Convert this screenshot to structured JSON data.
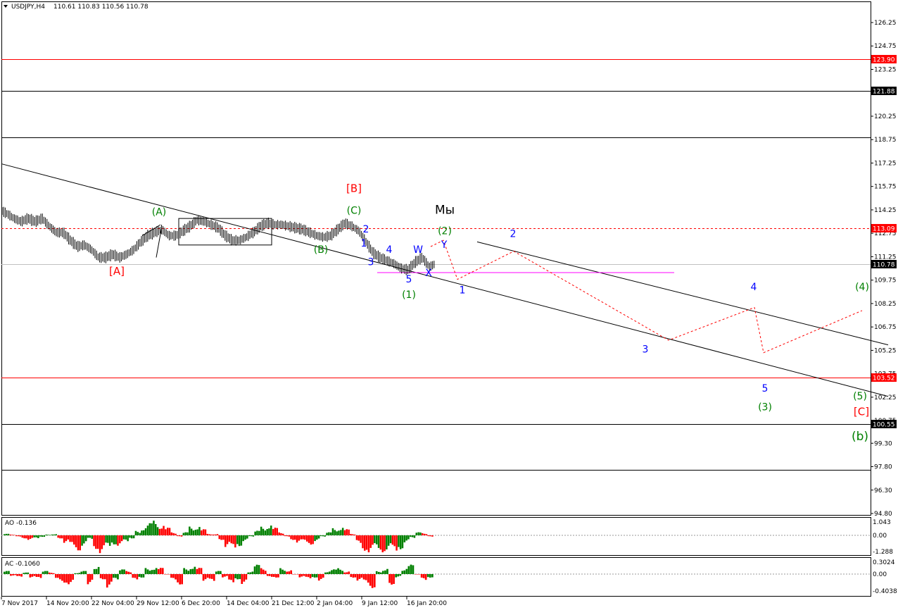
{
  "header": {
    "symbol": "USDJPY,H4",
    "ohlc": "110.61 110.83 110.56 110.78"
  },
  "indicators": {
    "ao": {
      "label": "AO -0.136",
      "ticks": [
        "1.043",
        "0.00",
        "-1.288"
      ]
    },
    "ac": {
      "label": "AC -0.1060",
      "ticks": [
        "0.3024",
        "0.00",
        "-0.4038"
      ]
    }
  },
  "colors": {
    "level_red": "#ff0000",
    "wave_blue": "#0000ff",
    "wave_green": "#008000",
    "forecast": "#ff0000",
    "bar": "#000000",
    "ao_up": "#008000",
    "ao_down": "#ff0000",
    "magenta_line": "#ff00ff",
    "ask_line": "#ff0000"
  },
  "chart_data": {
    "type": "line",
    "title": "USDJPY,H4",
    "y_axis": {
      "ticks": [
        "126.25",
        "124.75",
        "123.25",
        "121.75",
        "120.25",
        "118.75",
        "117.25",
        "115.75",
        "114.25",
        "112.75",
        "111.25",
        "109.75",
        "108.25",
        "106.75",
        "105.25",
        "103.75",
        "102.25",
        "100.75",
        "99.30",
        "97.80",
        "96.30",
        "94.80"
      ],
      "range": [
        94.2,
        127.3
      ]
    },
    "x_axis": {
      "labels": [
        "7 Nov 2017",
        "14 Nov 20:00",
        "22 Nov 04:00",
        "29 Nov 12:00",
        "6 Dec 20:00",
        "14 Dec 04:00",
        "21 Dec 12:00",
        "2 Jan 04:00",
        "9 Jan 12:00",
        "16 Jan 20:00"
      ],
      "range": [
        0,
        1230
      ]
    },
    "price_labels": [
      {
        "value": 123.9,
        "text": "123.90",
        "type": "red"
      },
      {
        "value": 121.88,
        "text": "121.88",
        "type": "black"
      },
      {
        "value": 113.09,
        "text": "113.09",
        "type": "red"
      },
      {
        "value": 110.78,
        "text": "110.78",
        "type": "black"
      },
      {
        "value": 103.52,
        "text": "103.52",
        "type": "red"
      },
      {
        "value": 100.55,
        "text": "100.55",
        "type": "black"
      }
    ],
    "horizontal_levels": [
      {
        "value": 123.9,
        "kind": "red_solid"
      },
      {
        "value": 121.88,
        "kind": "black_solid"
      },
      {
        "value": 118.9,
        "kind": "black_solid"
      },
      {
        "value": 113.09,
        "kind": "red_dashed"
      },
      {
        "value": 110.78,
        "kind": "gray_solid"
      },
      {
        "value": 103.52,
        "kind": "red_solid"
      },
      {
        "value": 100.55,
        "kind": "black_solid"
      },
      {
        "value": 97.6,
        "kind": "black_solid"
      }
    ],
    "series": [
      {
        "name": "",
        "kind": "price",
        "points": [
          [
            2,
            114.2
          ],
          [
            10,
            114.0
          ],
          [
            20,
            113.7
          ],
          [
            30,
            113.5
          ],
          [
            40,
            113.7
          ],
          [
            50,
            113.5
          ],
          [
            60,
            113.7
          ],
          [
            70,
            113.2
          ],
          [
            80,
            112.8
          ],
          [
            90,
            112.8
          ],
          [
            100,
            112.3
          ],
          [
            110,
            111.9
          ],
          [
            120,
            112.0
          ],
          [
            130,
            111.7
          ],
          [
            140,
            111.2
          ],
          [
            150,
            111.2
          ],
          [
            160,
            111.4
          ],
          [
            170,
            111.2
          ],
          [
            180,
            111.4
          ],
          [
            190,
            111.7
          ],
          [
            200,
            112.2
          ],
          [
            210,
            112.6
          ],
          [
            220,
            112.8
          ],
          [
            230,
            113.0
          ],
          [
            240,
            112.6
          ],
          [
            250,
            112.6
          ],
          [
            260,
            112.9
          ],
          [
            270,
            113.2
          ],
          [
            280,
            113.6
          ],
          [
            290,
            113.5
          ],
          [
            300,
            113.3
          ],
          [
            310,
            113.1
          ],
          [
            320,
            112.6
          ],
          [
            330,
            112.3
          ],
          [
            340,
            112.3
          ],
          [
            350,
            112.5
          ],
          [
            360,
            112.8
          ],
          [
            370,
            113.2
          ],
          [
            380,
            113.4
          ],
          [
            390,
            113.3
          ],
          [
            400,
            113.3
          ],
          [
            410,
            113.2
          ],
          [
            420,
            113.1
          ],
          [
            430,
            113.0
          ],
          [
            440,
            112.8
          ],
          [
            450,
            112.6
          ],
          [
            460,
            112.5
          ],
          [
            470,
            112.6
          ],
          [
            480,
            113.0
          ],
          [
            490,
            113.4
          ],
          [
            500,
            113.2
          ],
          [
            510,
            112.9
          ],
          [
            520,
            112.2
          ],
          [
            530,
            111.5
          ],
          [
            540,
            111.2
          ],
          [
            550,
            111.0
          ],
          [
            560,
            110.8
          ],
          [
            570,
            110.5
          ],
          [
            580,
            110.4
          ],
          [
            590,
            110.9
          ],
          [
            600,
            111.2
          ],
          [
            610,
            110.6
          ],
          [
            618,
            110.78
          ]
        ]
      },
      {
        "name": "",
        "kind": "forecast",
        "points": [
          [
            612,
            111.9
          ],
          [
            630,
            112.3
          ],
          [
            650,
            109.8
          ],
          [
            730,
            111.6
          ],
          [
            950,
            105.9
          ],
          [
            1072,
            108.0
          ],
          [
            1085,
            105.1
          ],
          [
            1225,
            107.8
          ]
        ]
      }
    ],
    "trendlines": [
      {
        "from": [
          2,
          117.2
        ],
        "to": [
          1262,
          102.3
        ]
      },
      {
        "from": [
          678,
          112.2
        ],
        "to": [
          1262,
          105.6
        ]
      }
    ],
    "annotations": [
      {
        "text": "[B]",
        "x": 503,
        "y": 115.4,
        "color": "red",
        "size": 15
      },
      {
        "text": "(C)",
        "x": 503,
        "y": 114.0,
        "color": "green",
        "size": 14
      },
      {
        "text": "(A)",
        "x": 226,
        "y": 113.9,
        "color": "green",
        "size": 14
      },
      {
        "text": "(B)",
        "x": 456,
        "y": 111.5,
        "color": "green",
        "size": 14
      },
      {
        "text": "[A]",
        "x": 166,
        "y": 110.1,
        "color": "red",
        "size": 15
      },
      {
        "text": "Мы",
        "x": 632,
        "y": 114.0,
        "color": "black",
        "size": 17
      },
      {
        "text": "(2)",
        "x": 632,
        "y": 112.7,
        "color": "green",
        "size": 14
      },
      {
        "text": "2",
        "x": 520,
        "y": 112.8,
        "color": "blue",
        "size": 14
      },
      {
        "text": "1",
        "x": 517,
        "y": 111.9,
        "color": "blue",
        "size": 14
      },
      {
        "text": "4",
        "x": 553,
        "y": 111.5,
        "color": "blue",
        "size": 14
      },
      {
        "text": "W",
        "x": 594,
        "y": 111.5,
        "color": "blue",
        "size": 14
      },
      {
        "text": "Y",
        "x": 631,
        "y": 111.8,
        "color": "blue",
        "size": 14
      },
      {
        "text": "3",
        "x": 527,
        "y": 110.7,
        "color": "blue",
        "size": 14
      },
      {
        "text": "X",
        "x": 609,
        "y": 110.0,
        "color": "blue",
        "size": 14
      },
      {
        "text": "5",
        "x": 581,
        "y": 109.6,
        "color": "blue",
        "size": 14
      },
      {
        "text": "(1)",
        "x": 581,
        "y": 108.6,
        "color": "green",
        "size": 14
      },
      {
        "text": "1",
        "x": 657,
        "y": 108.9,
        "color": "blue",
        "size": 14
      },
      {
        "text": "2",
        "x": 729,
        "y": 112.5,
        "color": "blue",
        "size": 14
      },
      {
        "text": "4",
        "x": 1071,
        "y": 109.1,
        "color": "blue",
        "size": 14
      },
      {
        "text": "3",
        "x": 917,
        "y": 105.1,
        "color": "blue",
        "size": 14
      },
      {
        "text": "(4)",
        "x": 1225,
        "y": 109.1,
        "color": "green",
        "size": 14
      },
      {
        "text": "5",
        "x": 1087,
        "y": 102.6,
        "color": "blue",
        "size": 14
      },
      {
        "text": "(3)",
        "x": 1087,
        "y": 101.4,
        "color": "green",
        "size": 14
      },
      {
        "text": "(5)",
        "x": 1222,
        "y": 102.1,
        "color": "green",
        "size": 14
      },
      {
        "text": "[C]",
        "x": 1224,
        "y": 101.1,
        "color": "red",
        "size": 15
      },
      {
        "text": "(b)",
        "x": 1222,
        "y": 99.5,
        "color": "green",
        "size": 17
      }
    ],
    "ao_values": [
      0.1,
      0.05,
      -0.1,
      -0.2,
      -0.3,
      -0.25,
      -0.1,
      0.05,
      0.1,
      -0.2,
      -0.5,
      -0.8,
      -1.0,
      -0.7,
      -0.3,
      -0.9,
      -1.2,
      -0.9,
      -0.6,
      -0.7,
      -0.5,
      -0.2,
      0.3,
      0.6,
      0.8,
      1.0,
      0.8,
      0.5,
      0.2,
      -0.1,
      0.2,
      0.6,
      0.7,
      0.4,
      0.1,
      0.1,
      -0.3,
      -0.8,
      -1.0,
      -0.7,
      -0.4,
      -0.1,
      0.3,
      0.6,
      0.8,
      0.5,
      0.2,
      -0.1,
      -0.3,
      -0.5,
      -0.5,
      -0.6,
      -0.4,
      -0.1,
      0.2,
      0.5,
      0.6,
      0.4,
      0.1,
      -0.6,
      -1.0,
      -1.2,
      -1.0,
      -1.1,
      -1.0,
      -1.2,
      -0.9,
      -0.5,
      -0.2,
      0.2,
      0.15,
      -0.1
    ],
    "ac_values": [
      0.1,
      -0.05,
      -0.1,
      0.05,
      -0.1,
      -0.15,
      0.1,
      0.05,
      -0.2,
      -0.25,
      -0.3,
      0.05,
      0.1,
      -0.3,
      0.3,
      -0.15,
      -0.4,
      -0.2,
      0.15,
      0.1,
      -0.2,
      -0.1,
      0.2,
      0.25,
      0.2,
      0.0,
      -0.2,
      -0.3,
      0.2,
      0.3,
      0.2,
      -0.2,
      -0.25,
      0.1,
      -0.1,
      -0.3,
      -0.15,
      -0.3,
      0.1,
      0.3,
      0.2,
      -0.1,
      -0.1,
      0.2,
      0.15,
      0.0,
      -0.1,
      -0.15,
      -0.1,
      -0.2,
      0.1,
      0.15,
      0.2,
      0.1,
      -0.1,
      -0.2,
      -0.3,
      -0.4,
      0.1,
      0.2,
      -0.3,
      -0.1,
      0.2,
      0.3,
      0.0,
      -0.2,
      -0.1
    ]
  }
}
